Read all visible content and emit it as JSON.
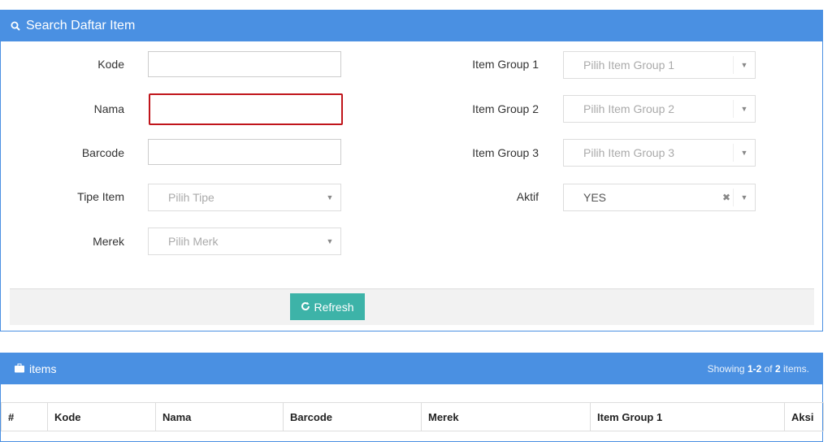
{
  "search_panel": {
    "title": "Search Daftar Item",
    "fields": {
      "kode_label": "Kode",
      "nama_label": "Nama",
      "barcode_label": "Barcode",
      "tipe_item_label": "Tipe Item",
      "tipe_item_placeholder": "Pilih Tipe",
      "merek_label": "Merek",
      "merek_placeholder": "Pilih Merk",
      "item_group1_label": "Item Group 1",
      "item_group1_placeholder": "Pilih Item Group 1",
      "item_group2_label": "Item Group 2",
      "item_group2_placeholder": "Pilih Item Group 2",
      "item_group3_label": "Item Group 3",
      "item_group3_placeholder": "Pilih Item Group 3",
      "aktif_label": "Aktif",
      "aktif_value": "YES"
    },
    "refresh_label": "Refresh"
  },
  "items_panel": {
    "title": "items",
    "showing_prefix": "Showing ",
    "showing_range": "1-2",
    "showing_of": " of ",
    "showing_total": "2",
    "showing_suffix": " items.",
    "columns": [
      "#",
      "Kode",
      "Nama",
      "Barcode",
      "Merek",
      "Item Group 1",
      "Aksi"
    ]
  },
  "colors": {
    "panel_header": "#4a90e2",
    "refresh_button": "#3db3a8",
    "error_border": "#c0151b"
  }
}
